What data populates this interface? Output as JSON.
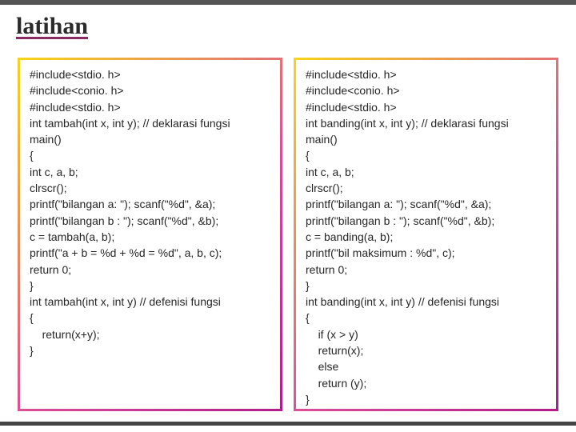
{
  "title": "latihan",
  "panels": {
    "left": "#include<stdio. h>\n#include<conio. h>\n#include<stdio. h>\nint tambah(int x, int y); // deklarasi fungsi\nmain()\n{\nint c, a, b;\nclrscr();\nprintf(\"bilangan a: \"); scanf(\"%d\", &a);\nprintf(\"bilangan b : \"); scanf(\"%d\", &b);\nc = tambah(a, b);\nprintf(\"a + b = %d + %d = %d\", a, b, c);\nreturn 0;\n}\nint tambah(int x, int y) // defenisi fungsi\n{\n    return(x+y);\n}",
    "right": "#include<stdio. h>\n#include<conio. h>\n#include<stdio. h>\nint banding(int x, int y); // deklarasi fungsi\nmain()\n{\nint c, a, b;\nclrscr();\nprintf(\"bilangan a: \"); scanf(\"%d\", &a);\nprintf(\"bilangan b : \"); scanf(\"%d\", &b);\nc = banding(a, b);\nprintf(\"bil maksimum : %d\", c);\nreturn 0;\n}\nint banding(int x, int y) // defenisi fungsi\n{\n    if (x > y)\n    return(x);\n    else\n    return (y);\n}"
  }
}
